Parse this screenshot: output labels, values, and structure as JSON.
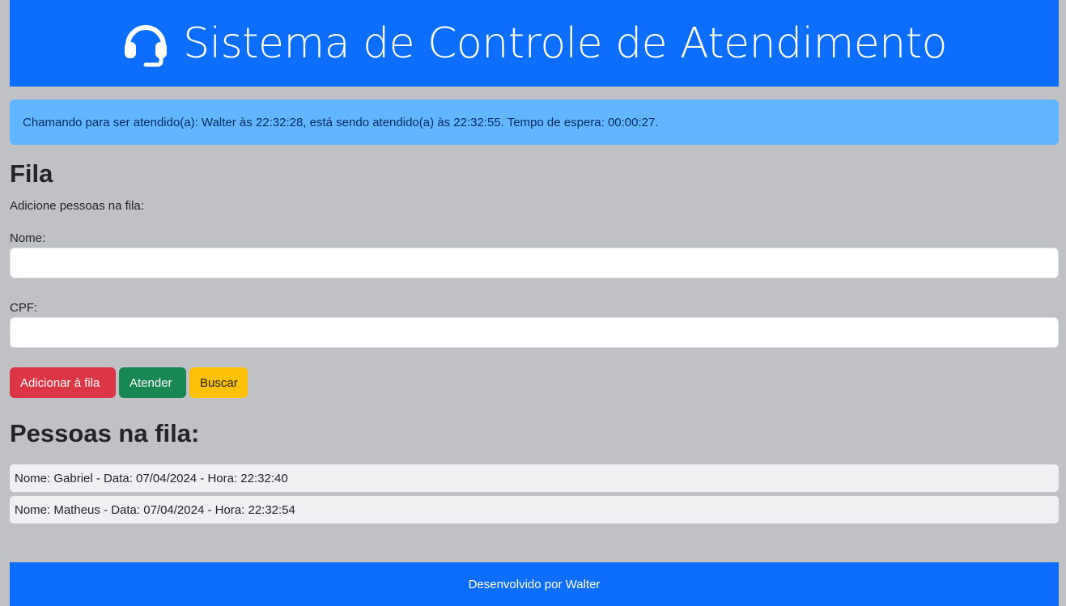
{
  "header": {
    "title": "Sistema de Controle de Atendimento",
    "icon": "headset-icon"
  },
  "alert": {
    "text": "Chamando para ser atendido(a): Walter às 22:32:28, está sendo atendido(a) às 22:32:55. Tempo de espera: 00:00:27."
  },
  "form": {
    "heading": "Fila",
    "subtitle": "Adicione pessoas na fila:",
    "nome_label": "Nome:",
    "nome_value": "",
    "cpf_label": "CPF:",
    "cpf_value": ""
  },
  "buttons": {
    "add_label": "Adicionar à fila",
    "atender_label": "Atender",
    "buscar_label": "Buscar"
  },
  "queue": {
    "heading": "Pessoas na fila:",
    "items": [
      "Nome: Gabriel - Data: 07/04/2024 - Hora: 22:32:40",
      "Nome: Matheus - Data: 07/04/2024 - Hora: 22:32:54"
    ]
  },
  "footer": {
    "text": "Desenvolvido por Walter"
  },
  "colors": {
    "primary": "#0d6efd",
    "alert_bg": "#61b6ff",
    "page_bg": "#c0c1c5",
    "danger": "#dc3545",
    "success": "#198754",
    "warning": "#ffc107"
  }
}
